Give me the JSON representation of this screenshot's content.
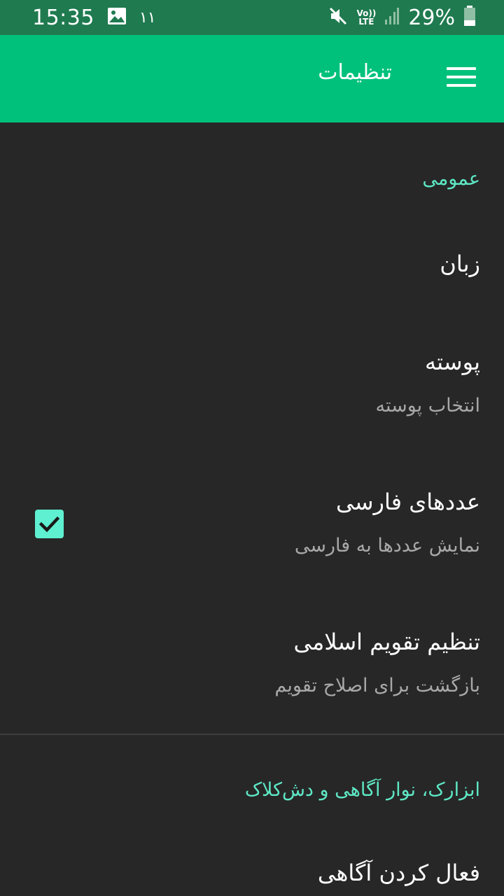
{
  "status_bar": {
    "time": "15:35",
    "notification_count": "۱۱",
    "battery": "29%",
    "icons": [
      "image-icon",
      "mute-icon",
      "volte-icon",
      "signal-icon",
      "battery-icon"
    ],
    "volte_top": "Vo))",
    "volte_bottom": "LTE"
  },
  "app_bar": {
    "title": "تنظیمات",
    "menu_icon": "hamburger-menu-icon",
    "color": "#00c17b"
  },
  "sections": {
    "general": {
      "header": "عمومی",
      "language": {
        "title": "زبان"
      },
      "theme": {
        "title": "پوسته",
        "summary": "انتخاب پوسته"
      },
      "persian_digits": {
        "title": "عددهای فارسی",
        "summary": "نمایش عددها به فارسی",
        "checked": true
      },
      "islamic_offset": {
        "title": "تنظیم تقویم اسلامی",
        "summary": "بازگشت برای اصلاح تقویم"
      }
    },
    "widgets": {
      "header": "ابزارک، نوار آگاهی و دش‌کلاک",
      "notification": {
        "title": "فعال کردن آگاهی"
      }
    }
  },
  "colors": {
    "accent": "#5ee8c5",
    "background": "#272727",
    "status_bar": "#1f7a4f"
  }
}
